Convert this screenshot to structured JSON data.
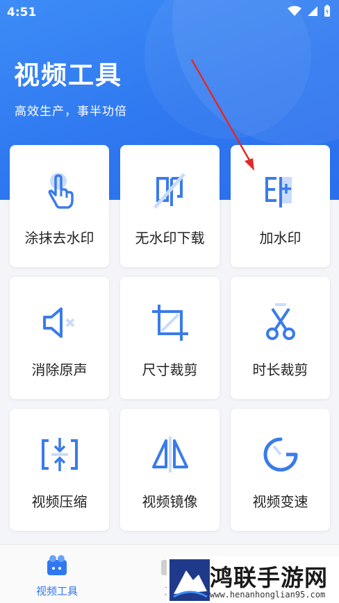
{
  "status_bar": {
    "time": "4:51"
  },
  "header": {
    "title": "视频工具",
    "subtitle": "高效生产，事半功倍"
  },
  "tools": [
    {
      "label": "涂抹去水印",
      "icon": "tap-finger-icon"
    },
    {
      "label": "无水印下载",
      "icon": "no-watermark-icon"
    },
    {
      "label": "加水印",
      "icon": "add-watermark-icon"
    },
    {
      "label": "消除原声",
      "icon": "mute-speaker-icon"
    },
    {
      "label": "尺寸裁剪",
      "icon": "crop-icon"
    },
    {
      "label": "时长裁剪",
      "icon": "scissors-icon"
    },
    {
      "label": "视频压缩",
      "icon": "compress-icon"
    },
    {
      "label": "视频镜像",
      "icon": "mirror-icon"
    },
    {
      "label": "视频变速",
      "icon": "speed-gauge-icon"
    }
  ],
  "bottom_nav": [
    {
      "label": "视频工具",
      "active": true
    },
    {
      "label": "工",
      "active": false
    }
  ],
  "watermark": {
    "title": "鸿联手游网",
    "url": "www.henanhonglian95.com"
  },
  "colors": {
    "accent": "#2f78f0",
    "icon_blue": "#3a7bea",
    "arrow": "#e02a2a"
  }
}
